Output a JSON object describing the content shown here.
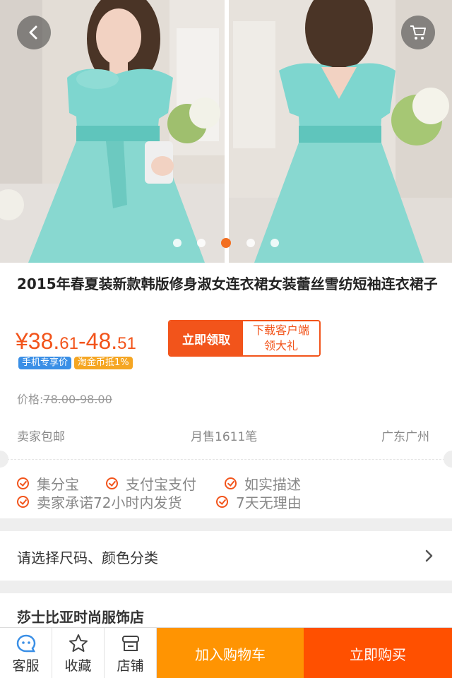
{
  "product": {
    "title": "2015年春夏装新款韩版修身淑女连衣裙女装蕾丝雪纺短袖连衣裙子",
    "price_main": "¥38.",
    "price_cents1": "61",
    "price_sep": "-48.",
    "price_cents2": "51",
    "tags": [
      "手机专享价",
      "淘金币抵1%"
    ],
    "orig_price_label": "价格:",
    "orig_price_value": "78.00-98.00"
  },
  "promo": {
    "left": "立即领取",
    "right_line1": "下载客户端",
    "right_line2": "领大礼"
  },
  "shipping": {
    "free_shipping": "卖家包邮",
    "monthly_sales": "月售1611笔",
    "location": "广东广州"
  },
  "guarantees": [
    "集分宝",
    "支付宝支付",
    "如实描述",
    "卖家承诺72小时内发货",
    "7天无理由"
  ],
  "select_options": "请选择尺码、颜色分类",
  "shop": {
    "name": "莎士比亚时尚服饰店"
  },
  "carousel": {
    "count": 5,
    "active": 2
  },
  "colors": {
    "accent": "#f2541b",
    "cart": "#ff9402",
    "buy": "#ff5000"
  },
  "icons": {
    "back": "back-arrow-icon",
    "cart": "cart-icon"
  },
  "bottom_bar": {
    "service": "客服",
    "favorite": "收藏",
    "store": "店铺",
    "add_to_cart": "加入购物车",
    "buy_now": "立即购买"
  }
}
